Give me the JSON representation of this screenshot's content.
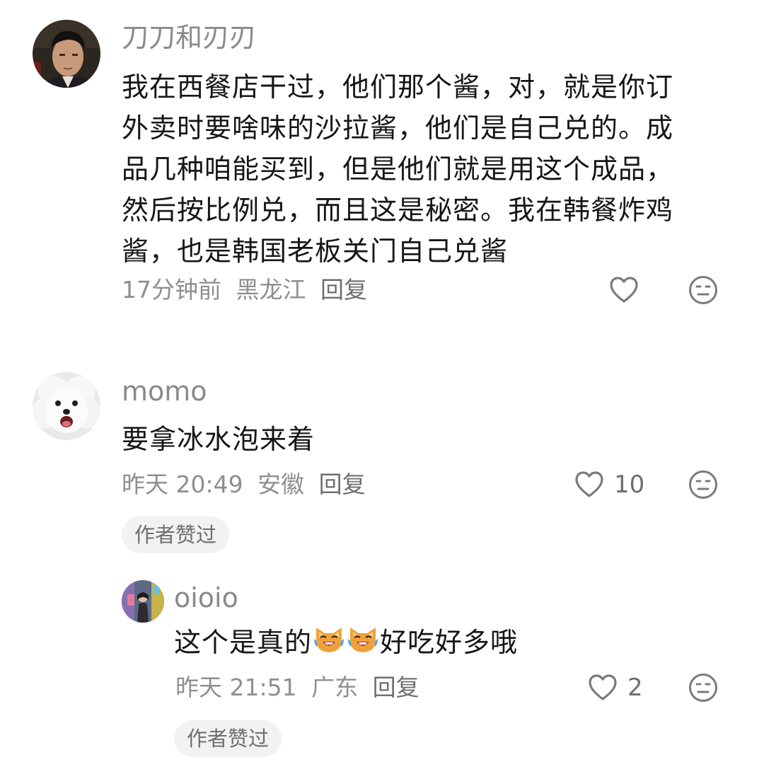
{
  "comments": [
    {
      "username": "刀刀和刃刃",
      "lines": [
        "我在西餐店干过，他们那个酱，对，就是你订",
        "外卖时要啥味的沙拉酱，他们是自己兑的。成",
        "品几种咱能买到，但是他们就是用这个成品，",
        "然后按比例兑，而且这是秘密。我在韩餐炸鸡",
        "酱，也是韩国老板关门自己兑酱"
      ],
      "time": "17分钟前",
      "location": "黑龙江",
      "reply_label": "回复",
      "like_count": ""
    },
    {
      "username": "momo",
      "text": "要拿冰水泡来着",
      "time": "昨天 20:49",
      "location": "安徽",
      "reply_label": "回复",
      "like_count": "10",
      "author_badge": "作者赞过",
      "replies": [
        {
          "username": "oioio",
          "text_before": "这个是真的",
          "emojis": [
            "laughing-cat-emoji",
            "laughing-cat-emoji"
          ],
          "text_after": "好吃好多哦",
          "time": "昨天 21:51",
          "location": "广东",
          "reply_label": "回复",
          "like_count": "2",
          "author_badge": "作者赞过"
        }
      ]
    }
  ],
  "icons": {
    "like": "heart-outline-icon",
    "dislike": "neutral-face-icon"
  },
  "colors": {
    "text_primary": "#161616",
    "text_secondary": "#8a8a8a",
    "badge_bg": "#f2f2f2"
  }
}
